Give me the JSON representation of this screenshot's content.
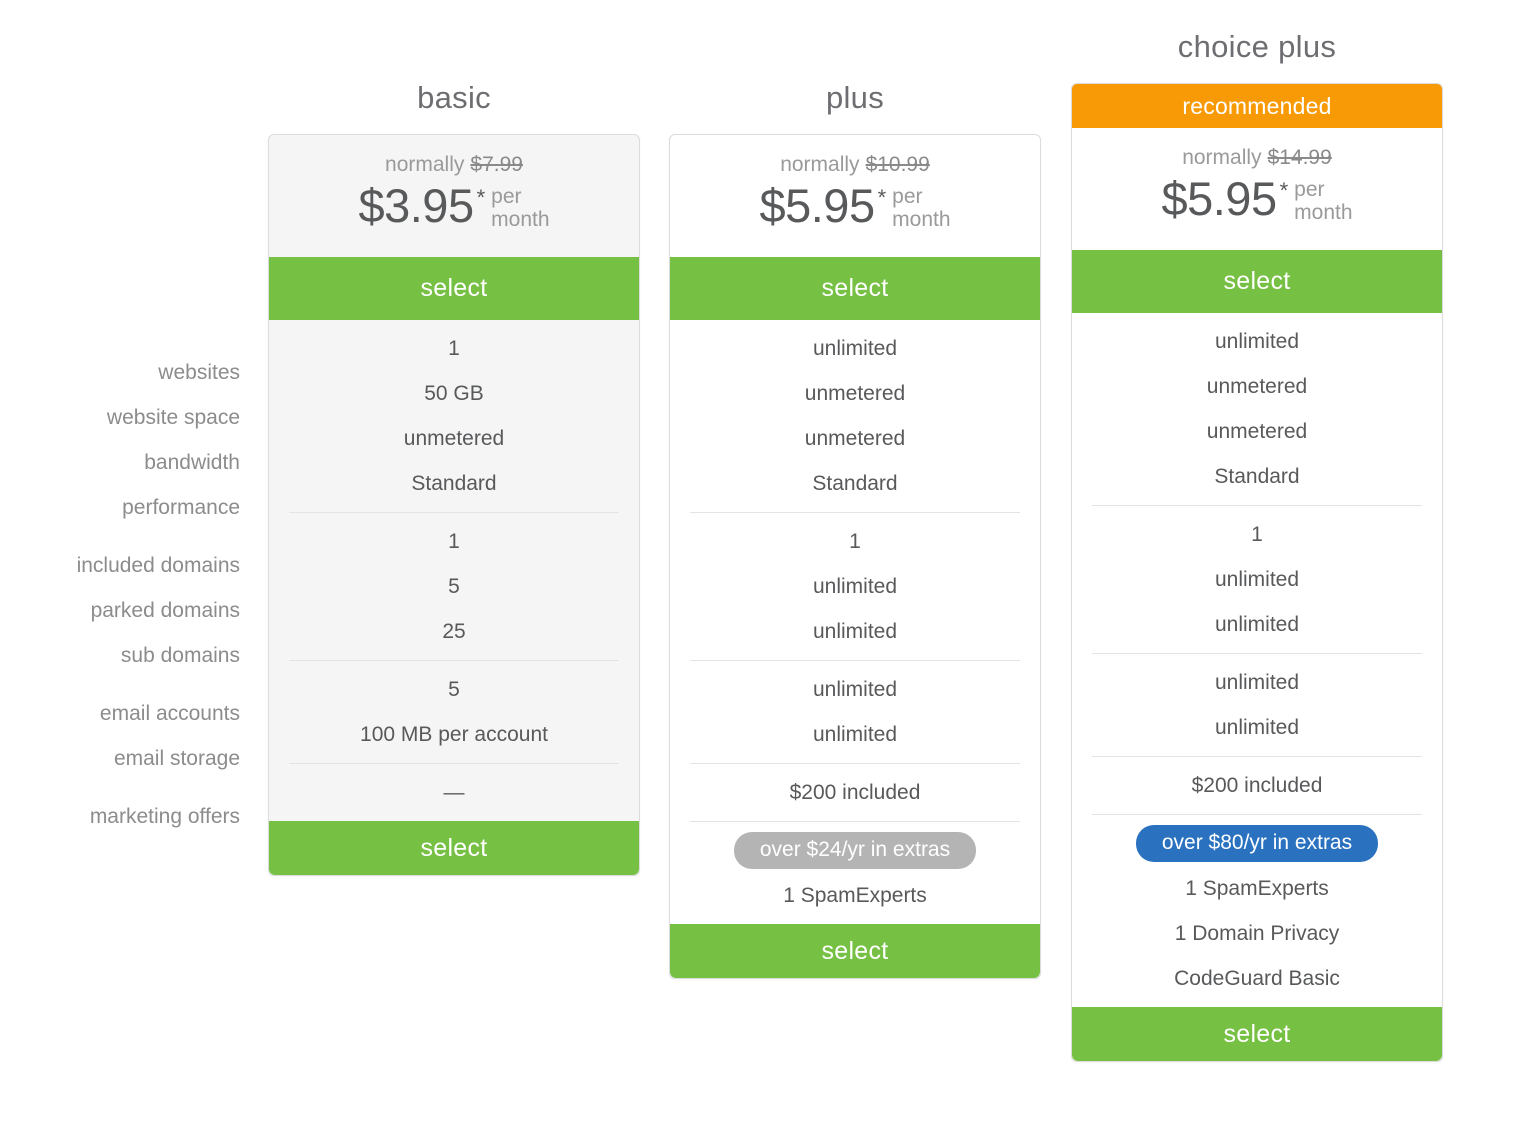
{
  "feature_labels": [
    {
      "label": "websites"
    },
    {
      "label": "website space"
    },
    {
      "label": "bandwidth"
    },
    {
      "label": "performance"
    },
    {
      "label": "included domains"
    },
    {
      "label": "parked domains"
    },
    {
      "label": "sub domains"
    },
    {
      "label": "email accounts"
    },
    {
      "label": "email storage"
    },
    {
      "label": "marketing offers"
    }
  ],
  "colors": {
    "green": "#76c043",
    "orange": "#f89a06",
    "blue": "#2a72c0",
    "gray_badge": "#b4b4b4",
    "card_gray_bg": "#f5f5f5",
    "card_border": "#dcdcdc",
    "text": "#58595b",
    "muted_text": "#8c8c8c"
  },
  "plans": {
    "basic": {
      "title": "basic",
      "normally_label": "normally",
      "normally_price": "$7.99",
      "price": "$3.95",
      "asterisk": "*",
      "per": "per",
      "month": "month",
      "select_top_label": "select",
      "select_bottom_label": "select",
      "values": {
        "websites": "1",
        "website_space": "50 GB",
        "bandwidth": "unmetered",
        "performance": "Standard",
        "included_domains": "1",
        "parked_domains": "5",
        "sub_domains": "25",
        "email_accounts": "5",
        "email_storage": "100 MB per account",
        "marketing_offers": "—"
      }
    },
    "plus": {
      "title": "plus",
      "normally_label": "normally",
      "normally_price": "$10.99",
      "price": "$5.95",
      "asterisk": "*",
      "per": "per",
      "month": "month",
      "select_top_label": "select",
      "select_bottom_label": "select",
      "values": {
        "websites": "unlimited",
        "website_space": "unmetered",
        "bandwidth": "unmetered",
        "performance": "Standard",
        "included_domains": "1",
        "parked_domains": "unlimited",
        "sub_domains": "unlimited",
        "email_accounts": "unlimited",
        "email_storage": "unlimited",
        "marketing_offers": "$200 included"
      },
      "extras_badge": "over $24/yr in extras",
      "extras": [
        {
          "text": "1 SpamExperts"
        }
      ]
    },
    "choice_plus": {
      "title": "choice plus",
      "ribbon": "recommended",
      "normally_label": "normally",
      "normally_price": "$14.99",
      "price": "$5.95",
      "asterisk": "*",
      "per": "per",
      "month": "month",
      "select_top_label": "select",
      "select_bottom_label": "select",
      "values": {
        "websites": "unlimited",
        "website_space": "unmetered",
        "bandwidth": "unmetered",
        "performance": "Standard",
        "included_domains": "1",
        "parked_domains": "unlimited",
        "sub_domains": "unlimited",
        "email_accounts": "unlimited",
        "email_storage": "unlimited",
        "marketing_offers": "$200 included"
      },
      "extras_badge": "over $80/yr in extras",
      "extras": [
        {
          "text": "1 SpamExperts"
        },
        {
          "text": "1 Domain Privacy"
        },
        {
          "text": "CodeGuard Basic"
        }
      ]
    }
  }
}
